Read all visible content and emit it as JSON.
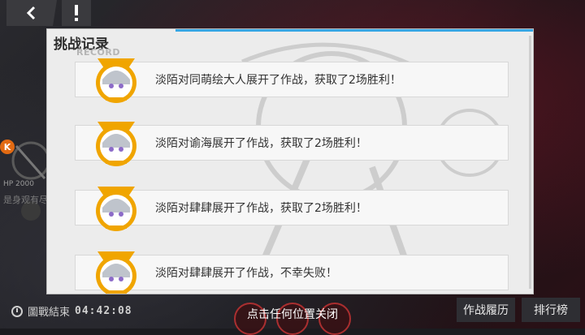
{
  "topbar": {
    "back_icon": "chevron-left-icon",
    "warning_icon": "exclamation-icon"
  },
  "side_panel": {
    "badge": "K",
    "small_label": "HP 2000",
    "name_label": "是身观有尽"
  },
  "dialog": {
    "title": "挑战记录",
    "subtitle": "RECORD",
    "records": [
      {
        "text": "淡陌对同萌绘大人展开了作战，获取了2场胜利！"
      },
      {
        "text": "淡陌对谕海展开了作战，获取了2场胜利！"
      },
      {
        "text": "淡陌对肆肆展开了作战，获取了2场胜利！"
      },
      {
        "text": "淡陌对肆肆展开了作战，不幸失败！"
      }
    ],
    "accent_color": "#39a8e5",
    "avatar_badge_color": "#f0a500"
  },
  "footer": {
    "timer_label": "圖戰結束",
    "timer_value": "04:42:08",
    "close_hint": "点击任何位置关闭",
    "history_button": "作战履历",
    "rank_button": "排行榜"
  }
}
